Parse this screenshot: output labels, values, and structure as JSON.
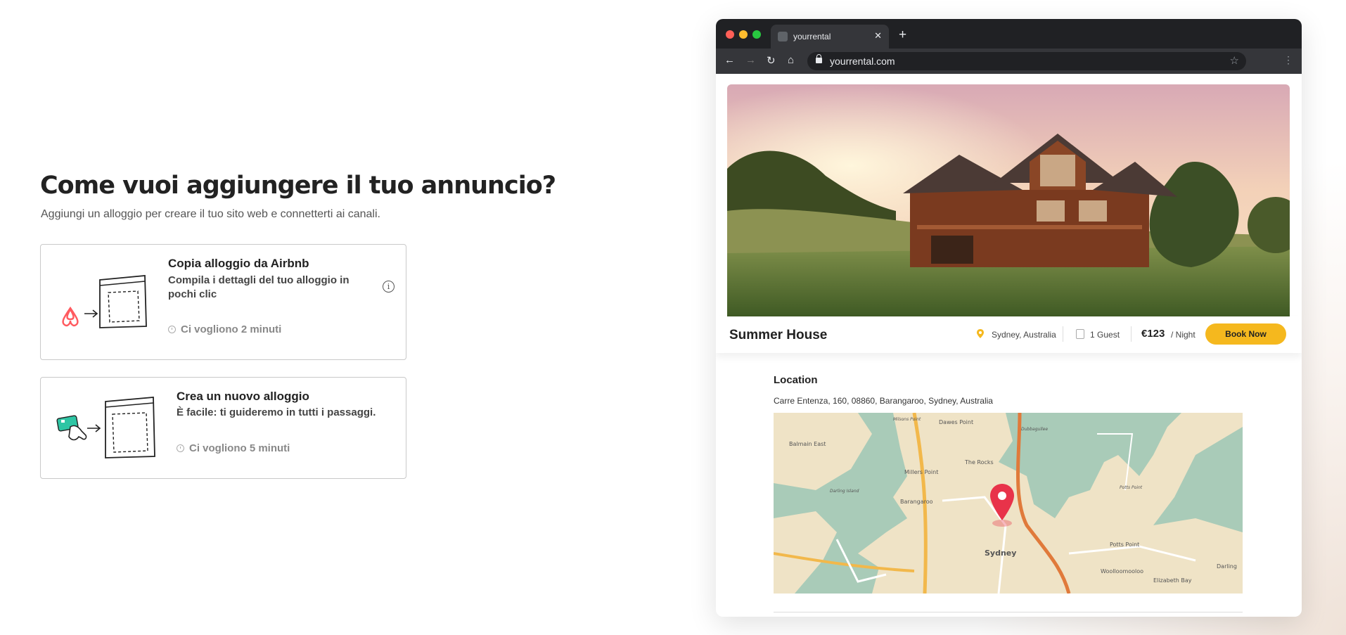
{
  "page": {
    "heading": "Come vuoi aggiungere il tuo annuncio?",
    "subheading": "Aggiungi un alloggio per creare il tuo sito web e connetterti ai canali."
  },
  "options": [
    {
      "title": "Copia alloggio da Airbnb",
      "description": "Compila i dettagli del tuo alloggio in pochi clic",
      "time": "Ci vogliono 2 minuti",
      "icon": "airbnb-logo-icon"
    },
    {
      "title": "Crea un nuovo alloggio",
      "description": "È facile: ti guideremo in tutti i passaggi.",
      "time": "Ci vogliono 5 minuti",
      "icon": "hand-card-icon"
    }
  ],
  "browser": {
    "tab_title": "yourrental",
    "url": "yourrental.com"
  },
  "listing": {
    "name": "Summer House",
    "location": "Sydney, Australia",
    "guests": "1 Guest",
    "price": "€123",
    "per": "/ Night",
    "book_label": "Book Now",
    "location_heading": "Location",
    "address": "Carre Entenza, 160, 08860, Barangaroo, Sydney, Australia"
  },
  "map_labels": [
    "Dawes Point",
    "Milsons Point",
    "Balmain East",
    "The Rocks",
    "Millers Point",
    "Dubbagullee",
    "Barangaroo",
    "Darling Island",
    "Potts Point",
    "Sydney",
    "Woolloomooloo",
    "Elizabeth Bay",
    "Darling",
    "Potts Point"
  ],
  "colors": {
    "accent": "#f5b81e",
    "pin": "#e8334a",
    "airbnb": "#ff5a5f",
    "card_green": "#2ec5a4"
  }
}
